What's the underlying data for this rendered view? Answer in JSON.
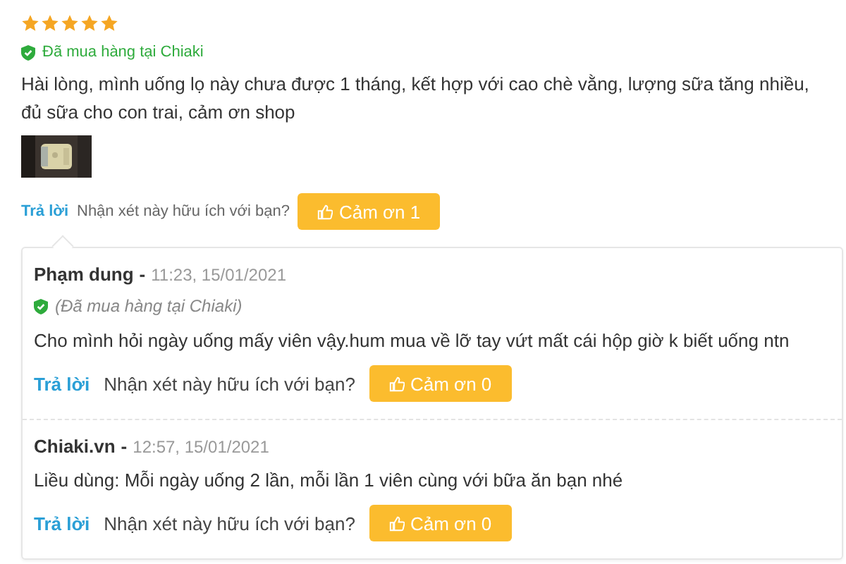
{
  "review": {
    "stars": 5,
    "verified": "Đã mua hàng tại Chiaki",
    "text": "Hài lòng, mình uống lọ này chưa được 1 tháng, kết hợp với cao chè vằng, lượng sữa tăng nhiều, đủ sữa cho con trai, cảm ơn shop",
    "photos": [
      {
        "kind": "picture"
      }
    ],
    "reply_link": "Trả lời",
    "helpful_question": "Nhận xét này hữu ích với bạn?",
    "thanks_button": "Cảm ơn 1"
  },
  "replies": [
    {
      "author": "Phạm dung",
      "separator": "-",
      "time": "11:23, 15/01/2021",
      "verified": "(Đã mua hàng tại Chiaki)",
      "text": "Cho mình hỏi ngày uống mấy viên vậy.hum mua về lỡ tay vứt mất cái hộp giờ k biết uống ntn",
      "reply_link": "Trả lời",
      "helpful_question": "Nhận xét này hữu ích với bạn?",
      "thanks_button": "Cảm ơn 0"
    },
    {
      "author": "Chiaki.vn",
      "separator": "-",
      "time": "12:57, 15/01/2021",
      "text": "Liều dùng: Mỗi ngày uống 2 lần, mỗi lần 1 viên cùng với bữa ăn bạn nhé",
      "reply_link": "Trả lời",
      "helpful_question": "Nhận xét này hữu ích với bạn?",
      "thanks_button": "Cảm ơn 0"
    }
  ]
}
